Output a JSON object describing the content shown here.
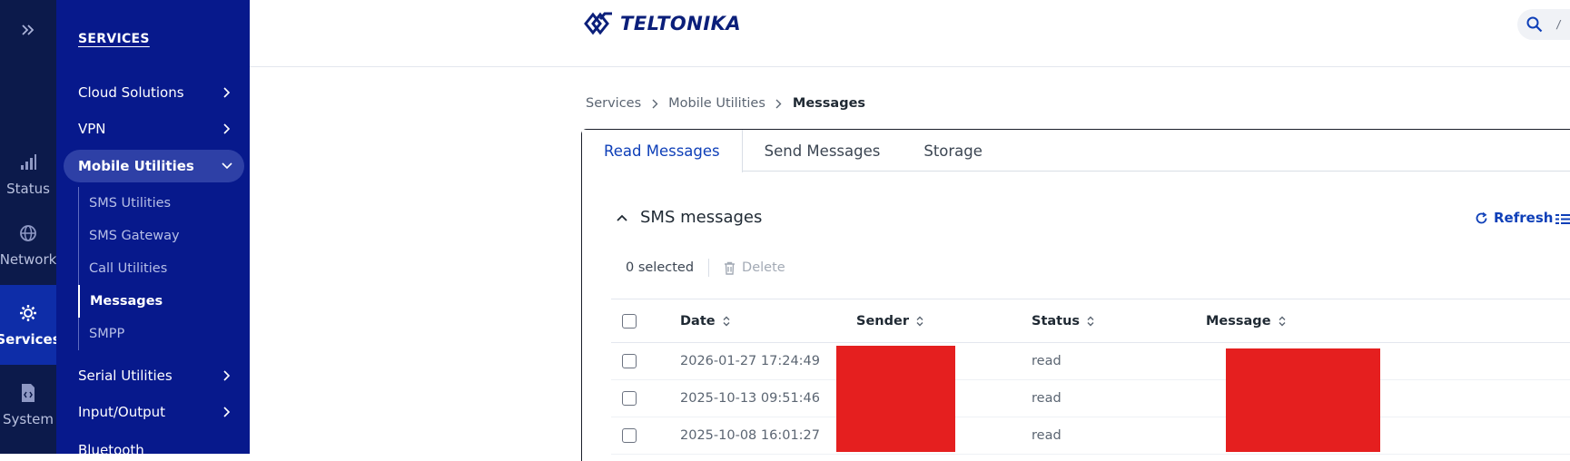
{
  "rail": {
    "items": [
      {
        "label": "Status",
        "icon": "signal-bars-icon",
        "active": false
      },
      {
        "label": "Network",
        "icon": "globe-icon",
        "active": false
      },
      {
        "label": "Services",
        "icon": "gear-icon",
        "active": true
      },
      {
        "label": "System",
        "icon": "file-code-icon",
        "active": false
      }
    ]
  },
  "menu": {
    "title": "SERVICES",
    "items": [
      {
        "label": "Cloud Solutions"
      },
      {
        "label": "VPN"
      },
      {
        "label": "Mobile Utilities"
      },
      {
        "label": "Serial Utilities"
      },
      {
        "label": "Input/Output"
      },
      {
        "label": "Bluetooth"
      }
    ],
    "submenu": [
      {
        "label": "SMS Utilities"
      },
      {
        "label": "SMS Gateway"
      },
      {
        "label": "Call Utilities"
      },
      {
        "label": "Messages"
      },
      {
        "label": "SMPP"
      }
    ]
  },
  "header": {
    "logo_text": "TELTONIKA",
    "search_shortcut": "/"
  },
  "breadcrumb": {
    "items": [
      "Services",
      "Mobile Utilities",
      "Messages"
    ]
  },
  "tabs": [
    {
      "label": "Read Messages",
      "active": true
    },
    {
      "label": "Send Messages",
      "active": false
    },
    {
      "label": "Storage",
      "active": false
    }
  ],
  "section": {
    "title": "SMS messages",
    "refresh_label": "Refresh"
  },
  "toolbar": {
    "selected_text": "0 selected",
    "delete_label": "Delete"
  },
  "table": {
    "columns": [
      "Date",
      "Sender",
      "Status",
      "Message"
    ],
    "rows": [
      {
        "date": "2026-01-27 17:24:49",
        "status": "read"
      },
      {
        "date": "2025-10-13 09:51:46",
        "status": "read"
      },
      {
        "date": "2025-10-08 16:01:27",
        "status": "read"
      }
    ]
  },
  "colors": {
    "rail_bg": "#0c1a4b",
    "menu_bg": "#07198c",
    "accent": "#0e3fb8",
    "redaction": "#e51f1f"
  }
}
